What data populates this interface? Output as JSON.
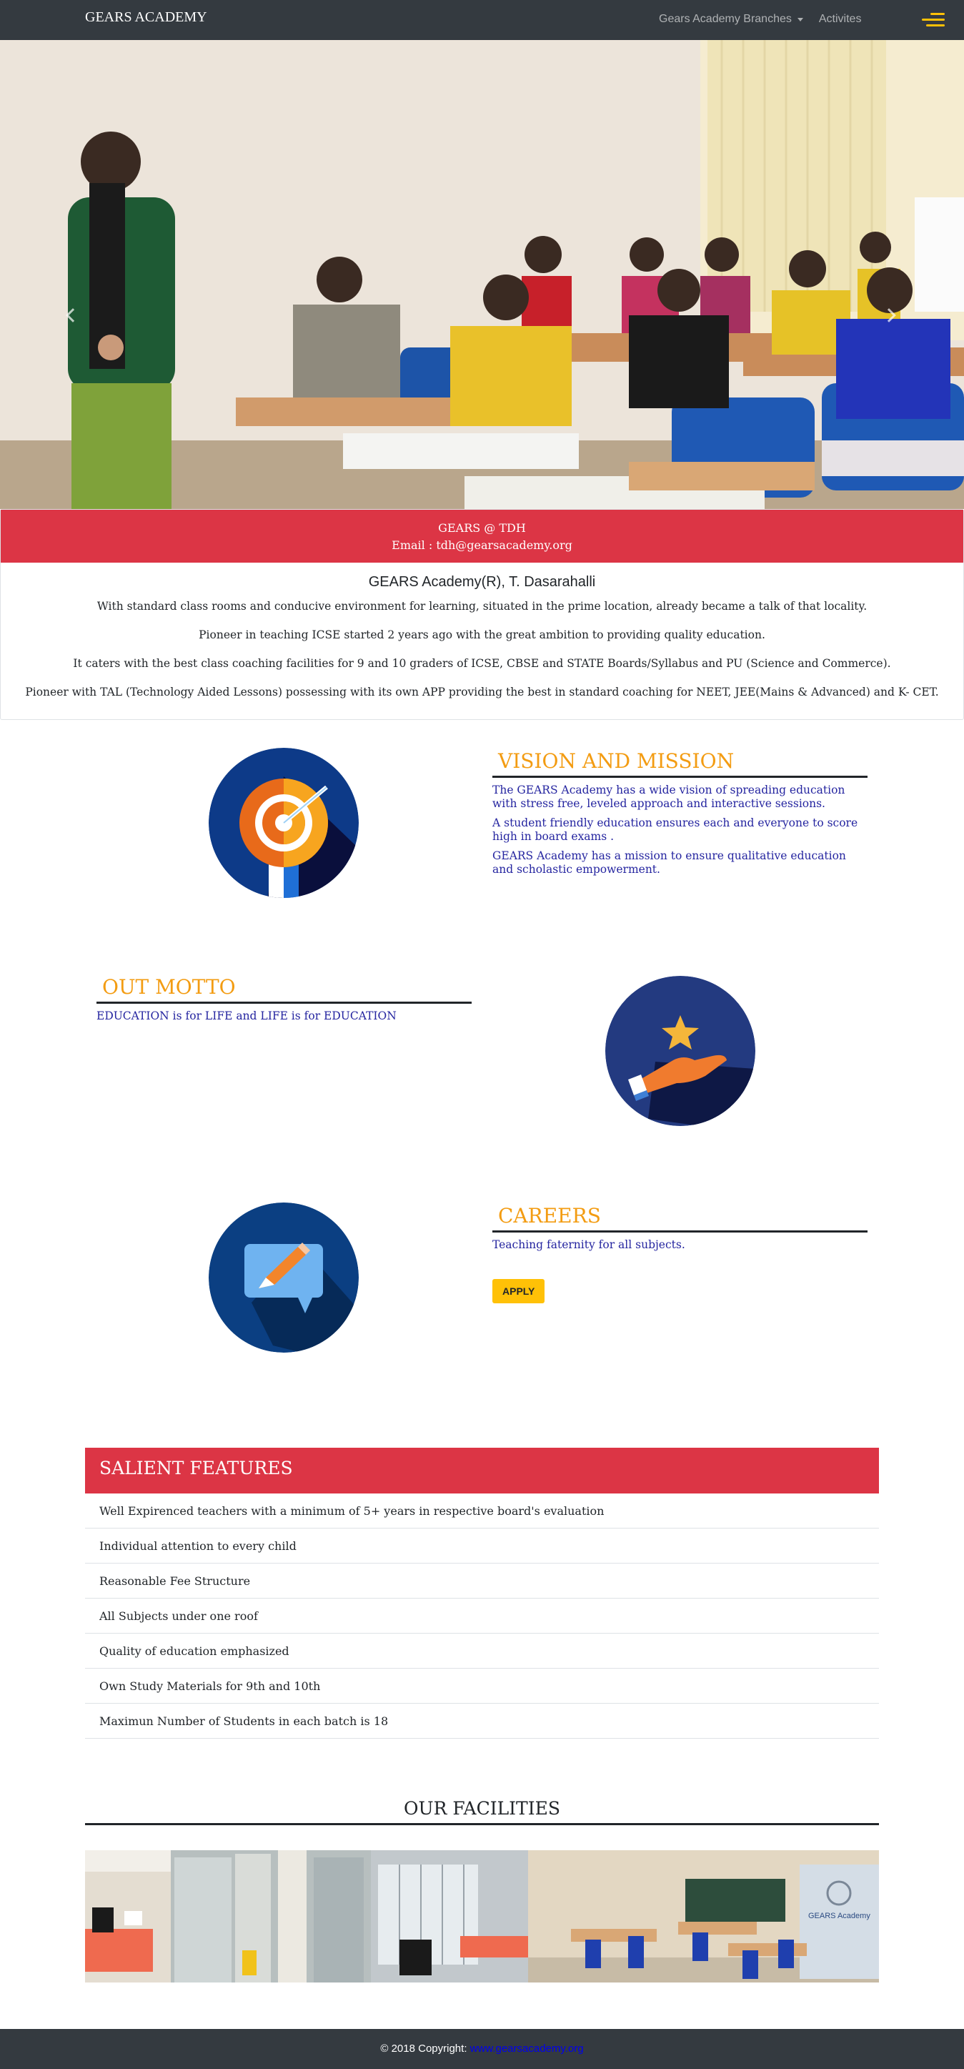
{
  "navbar": {
    "brand": "GEARS ACADEMY",
    "links": [
      "Gears Academy Branches",
      "Activites"
    ],
    "accent_color": "#ffc107",
    "menu_icon": "hamburger-icon"
  },
  "hero": {
    "prev_icon": "chevron-left-icon",
    "next_icon": "chevron-right-icon"
  },
  "info": {
    "header_line1": "GEARS @ TDH",
    "header_line2": "Email : tdh@gearsacademy.org",
    "title": "GEARS Academy(R), T. Dasarahalli",
    "paragraphs": [
      "With standard class rooms and conducive environment for learning, situated in the prime location, already became a talk of that locality.",
      "Pioneer in teaching ICSE started 2 years ago with the great ambition to providing quality education.",
      "It caters with the best class coaching facilities for 9 and 10 graders of ICSE, CBSE and STATE Boards/Syllabus and PU (Science and Commerce).",
      "Pioneer with TAL (Technology Aided Lessons) possessing with its own APP providing the best in standard coaching for NEET, JEE(Mains & Advanced) and K- CET."
    ]
  },
  "vision": {
    "heading": "VISION AND MISSION",
    "icon": "target-icon",
    "paragraphs": [
      "The GEARS Academy has a wide vision of spreading education with stress free, leveled approach and interactive sessions.",
      "A student friendly education ensures each and everyone to score high in board exams .",
      "GEARS Academy has a mission to ensure qualitative education and scholastic empowerment."
    ]
  },
  "motto": {
    "heading": "OUT MOTTO",
    "icon": "hand-star-icon",
    "text": "EDUCATION is for LIFE and LIFE is for EDUCATION"
  },
  "careers": {
    "heading": "CAREERS",
    "icon": "chat-pencil-icon",
    "text": "Teaching faternity for all subjects.",
    "button": "APPLY"
  },
  "salient": {
    "heading": "SALIENT FEATURES",
    "items": [
      "Well Expirenced teachers with a minimum of 5+ years in respective board's evaluation",
      "Individual attention to every child",
      "Reasonable Fee Structure",
      "All Subjects under one roof",
      "Quality of education emphasized",
      "Own Study Materials for 9th and 10th",
      "Maximun Number of Students in each batch is 18"
    ]
  },
  "facilities": {
    "heading": "OUR FACILITIES",
    "sign_text": "GEARS Academy"
  },
  "footer": {
    "copyright": "© 2018 Copyright:",
    "link": "www.gearsacademy.org"
  },
  "colors": {
    "navbar": "#343a40",
    "red": "#dc3545",
    "orange_heading": "#f39c12",
    "blue_text": "#2525a0",
    "yellow": "#ffc107"
  }
}
